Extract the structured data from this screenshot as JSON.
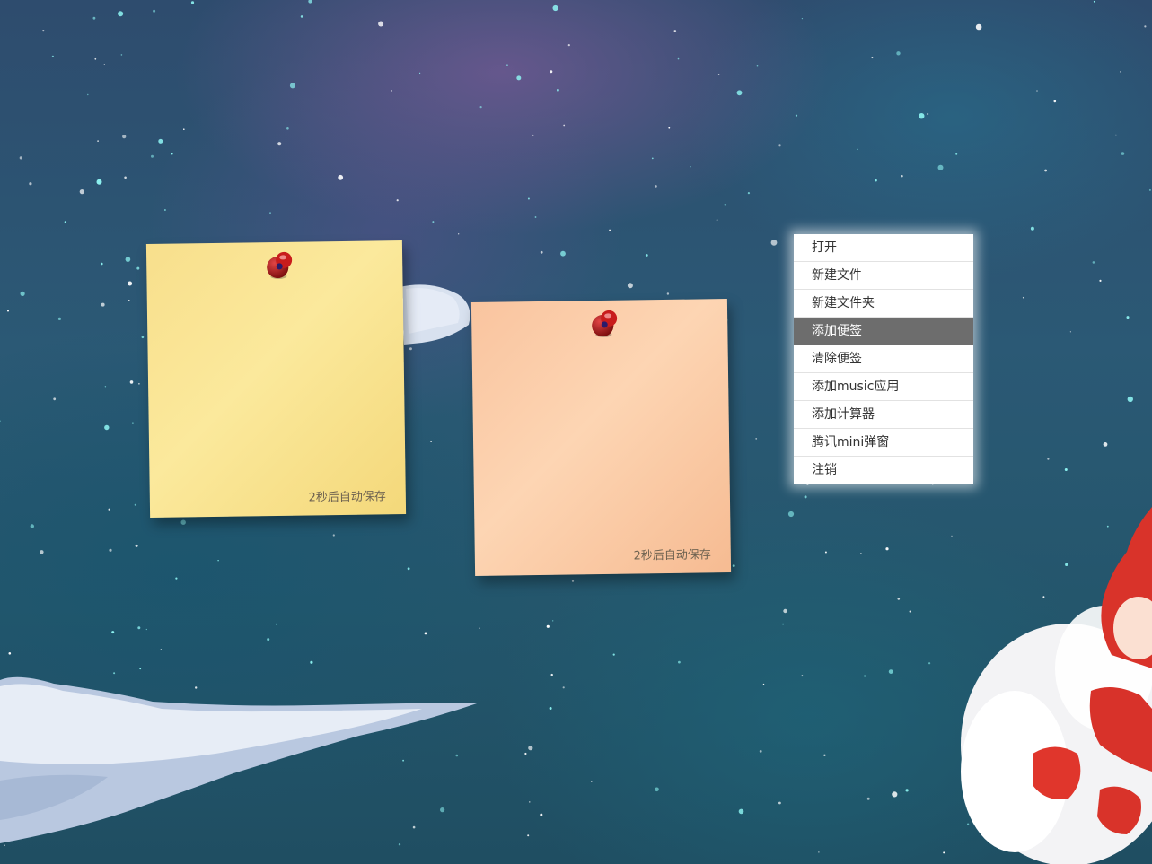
{
  "desktop": {
    "notes": [
      {
        "status": "2秒后自动保存",
        "color": "#fbe99c",
        "text": ""
      },
      {
        "status": "2秒后自动保存",
        "color": "#fdd5b3",
        "text": ""
      }
    ]
  },
  "context_menu": {
    "items": [
      {
        "label": "打开"
      },
      {
        "label": "新建文件"
      },
      {
        "label": "新建文件夹"
      },
      {
        "label": "添加便签",
        "active": true
      },
      {
        "label": "清除便签"
      },
      {
        "label": "添加music应用"
      },
      {
        "label": "添加计算器"
      },
      {
        "label": "腾讯mini弹窗"
      },
      {
        "label": "注销"
      }
    ],
    "active_background": "#6d6d6d"
  },
  "icons": {
    "pin": "pushpin-icon"
  }
}
